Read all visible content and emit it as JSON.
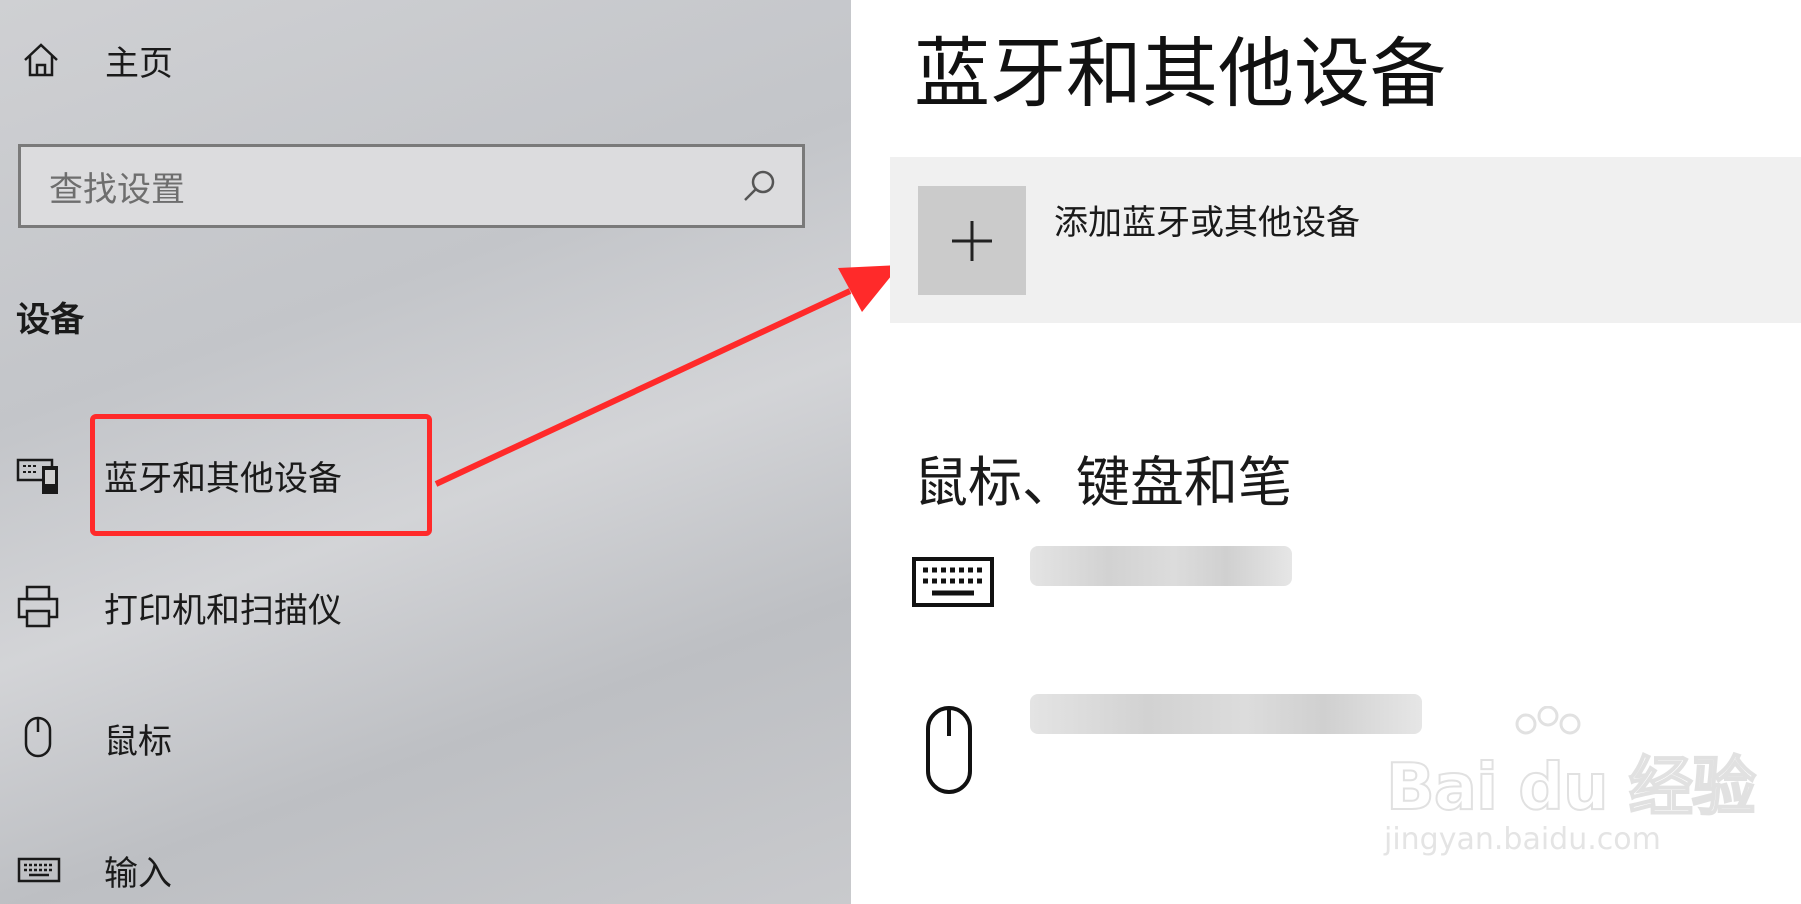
{
  "sidebar": {
    "home_label": "主页",
    "search_placeholder": "查找设置",
    "section_title": "设备",
    "items": [
      {
        "label": "蓝牙和其他设备",
        "icon": "bluetooth-devices-icon"
      },
      {
        "label": "打印机和扫描仪",
        "icon": "printer-icon"
      },
      {
        "label": "鼠标",
        "icon": "mouse-icon"
      },
      {
        "label": "输入",
        "icon": "keyboard-icon"
      }
    ]
  },
  "main": {
    "title": "蓝牙和其他设备",
    "add_device_label": "添加蓝牙或其他设备",
    "section_title": "鼠标、键盘和笔",
    "devices": [
      {
        "icon": "keyboard-icon"
      },
      {
        "icon": "mouse-icon"
      }
    ]
  },
  "watermark": {
    "brand": "Bai du 经验",
    "url": "jingyan.baidu.com"
  },
  "colors": {
    "highlight": "#ff2a2a",
    "sidebar_bg": "#c6c7ca",
    "add_panel_bg": "#f0f0f0"
  }
}
